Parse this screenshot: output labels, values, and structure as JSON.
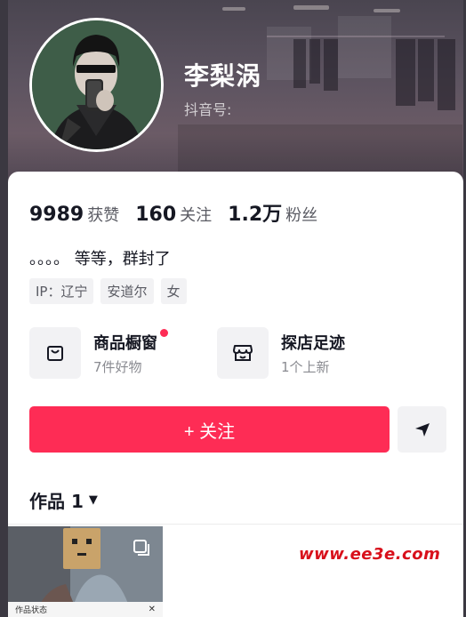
{
  "profile": {
    "name": "李梨涡",
    "douyin_id": "抖音号:"
  },
  "stats": [
    {
      "num": "9989",
      "label": "获赞"
    },
    {
      "num": "160",
      "label": "关注"
    },
    {
      "num": "1.2万",
      "label": "粉丝"
    }
  ],
  "bio": "。。。。 等等，群封了",
  "tags": [
    "IP：辽宁",
    "安道尔",
    "女"
  ],
  "features": [
    {
      "title": "商品橱窗",
      "sub": "7件好物",
      "icon": "shopping-bag-icon",
      "dot": true
    },
    {
      "title": "探店足迹",
      "sub": "1个上新",
      "icon": "store-icon",
      "dot": false
    }
  ],
  "actions": {
    "follow_label": "+ 关注",
    "more_icon": "triangle-send-icon"
  },
  "works": {
    "label": "作品 1",
    "caret": "▼",
    "thumb_caption": "作品状态",
    "thumb_close": "✕"
  },
  "watermark": "www.ee3e.com",
  "colors": {
    "accent": "#fe2c55",
    "watermark": "#d8101b"
  }
}
